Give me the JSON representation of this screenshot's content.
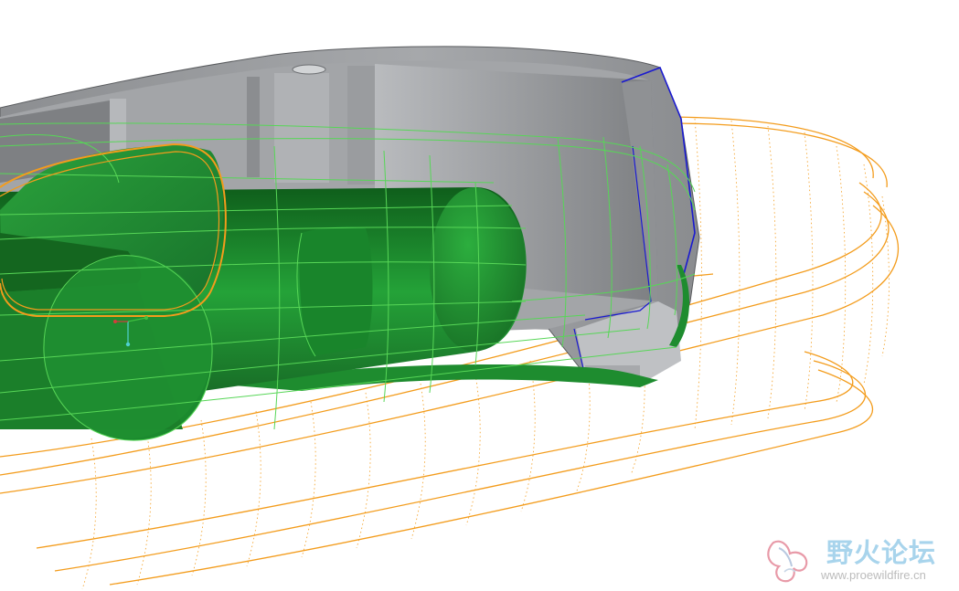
{
  "app": {
    "view": "3D model viewport"
  },
  "watermark": {
    "site_name": "野火论坛",
    "url": "www.proewildfire.cn"
  },
  "colors": {
    "background": "#ffffff",
    "shell": "#9c9ea1",
    "shell_inner": "#b4b6b9",
    "solid_green": "#1e8c2f",
    "wire_green": "#57d657",
    "wire_orange": "#f39c1c",
    "edge_blue": "#1a1ad0",
    "watermark_text": "#a8d4ec"
  },
  "icons": {
    "triad": "coordinate-triad-icon",
    "logo": "butterfly-logo-icon"
  }
}
